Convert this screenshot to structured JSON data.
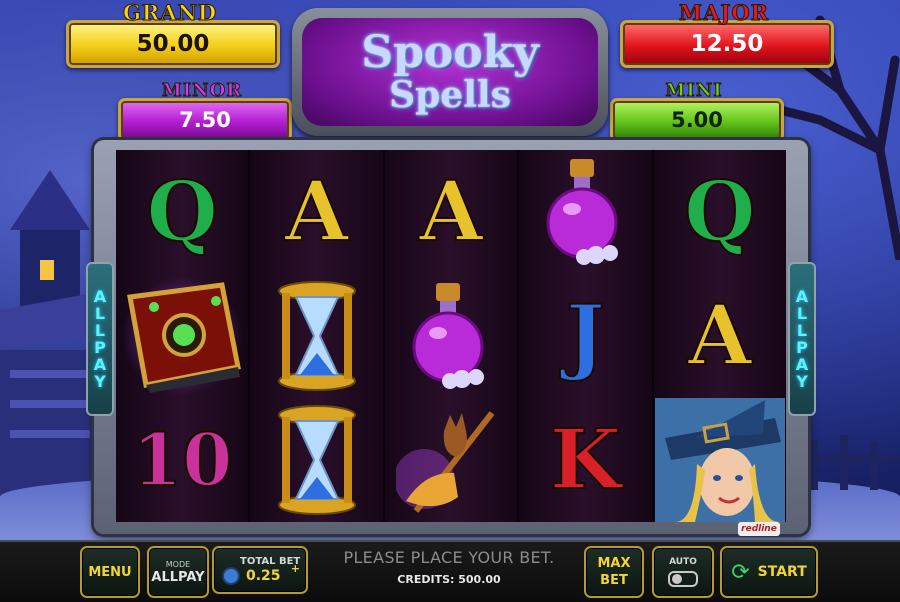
{
  "jackpots": {
    "grand": {
      "title": "GRAND",
      "value": "50.00"
    },
    "major": {
      "title": "MAJOR",
      "value": "12.50"
    },
    "minor": {
      "title": "MINOR",
      "value": "7.50"
    },
    "mini": {
      "title": "MINI",
      "value": "5.00"
    }
  },
  "logo": {
    "line1": "Spooky",
    "line2": "Spells"
  },
  "side_label_letters": [
    "A",
    "L",
    "L",
    "P",
    "A",
    "Y"
  ],
  "reels": [
    [
      "Q",
      "spellbook",
      "10"
    ],
    [
      "A",
      "hourglass",
      "hourglass"
    ],
    [
      "A",
      "potion",
      "broom-cat"
    ],
    [
      "potion",
      "J",
      "K"
    ],
    [
      "Q",
      "A",
      "witch"
    ]
  ],
  "footer": {
    "menu_label": "MENU",
    "mode_title": "MODE",
    "mode_value": "ALLPAY",
    "bet_title": "TOTAL BET",
    "bet_value": "0.25",
    "message": "PLEASE PLACE YOUR BET.",
    "credits": "CREDITS: 500.00",
    "maxbet_label": "MAX BET",
    "auto_label": "AUTO",
    "start_label": "START"
  },
  "provider_badge": "redline",
  "colors": {
    "grand": "#f3cf19",
    "major": "#e0141c",
    "minor": "#b21ed0",
    "mini": "#63c41a",
    "button_text": "#f2d437"
  }
}
